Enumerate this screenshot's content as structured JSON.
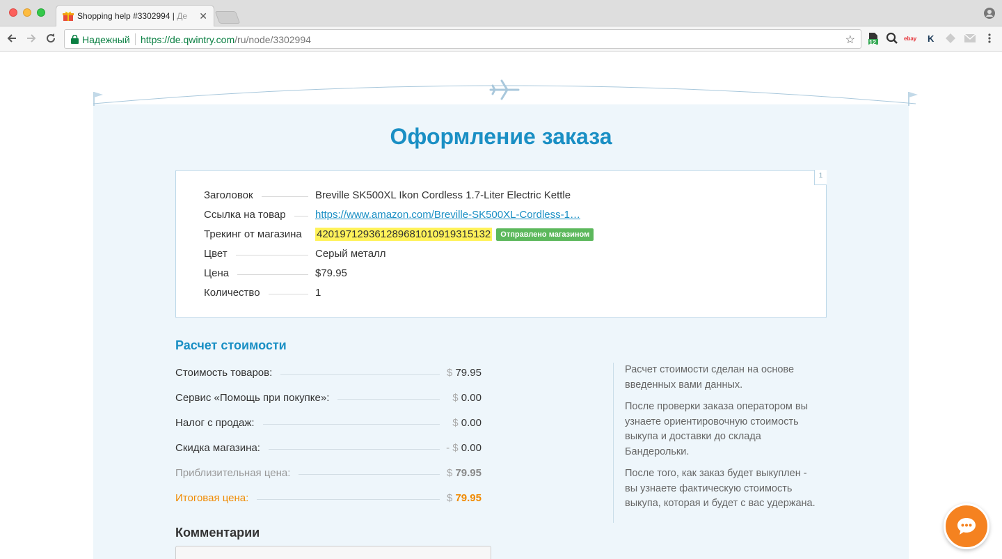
{
  "browser": {
    "tab_title": "Shopping help #3302994 | ",
    "tab_title_fade": "Де",
    "tab_close": "✕",
    "secure_label": "Надежный",
    "url_host": "https://de.qwintry.com",
    "url_path": "/ru/node/3302994",
    "star": "☆",
    "ext_badge": "12",
    "ext_ebay": "ebay",
    "ext_k": "K"
  },
  "page": {
    "title": "Оформление заказа",
    "box_number": "1"
  },
  "order": {
    "rows": [
      {
        "label": "Заголовок",
        "value": "Breville SK500XL Ikon Cordless 1.7-Liter Electric Kettle"
      },
      {
        "label": "Ссылка на товар",
        "value": "https://www.amazon.com/Breville-SK500XL-Cordless-1…"
      },
      {
        "label": "Трекинг от магазина",
        "value": "420197129361289681010919315132",
        "badge": "Отправлено магазином"
      },
      {
        "label": "Цвет",
        "value": "Серый металл"
      },
      {
        "label": "Цена",
        "value": "$79.95"
      },
      {
        "label": "Количество",
        "value": "1"
      }
    ]
  },
  "cost": {
    "title": "Расчет стоимости",
    "currency": "$",
    "minus": "- ",
    "rows": [
      {
        "label": "Стоимость товаров:",
        "value": "79.95"
      },
      {
        "label": "Сервис «Помощь при покупке»:",
        "value": "0.00"
      },
      {
        "label": "Налог с продаж:",
        "value": "0.00"
      },
      {
        "label": "Скидка магазина:",
        "value": "0.00"
      },
      {
        "label": "Приблизительная цена:",
        "value": "79.95"
      },
      {
        "label": "Итоговая цена:",
        "value": "79.95"
      }
    ]
  },
  "notes": [
    "Расчет стоимости сделан на основе введенных вами данных.",
    "После проверки заказа оператором вы узнаете ориентировочную стоимость выкупа и доставки до склада Бандерольки.",
    "После того, как заказ будет выкуплен - вы узнаете фактическую стоимость выкупа, которая и будет с вас удержана."
  ],
  "comments": {
    "title": "Комментарии"
  },
  "colors": {
    "accent": "#1a8fc4",
    "total": "#f08a00",
    "badge": "#5cb85c",
    "highlight": "#fff25a",
    "chat": "#f58220"
  }
}
